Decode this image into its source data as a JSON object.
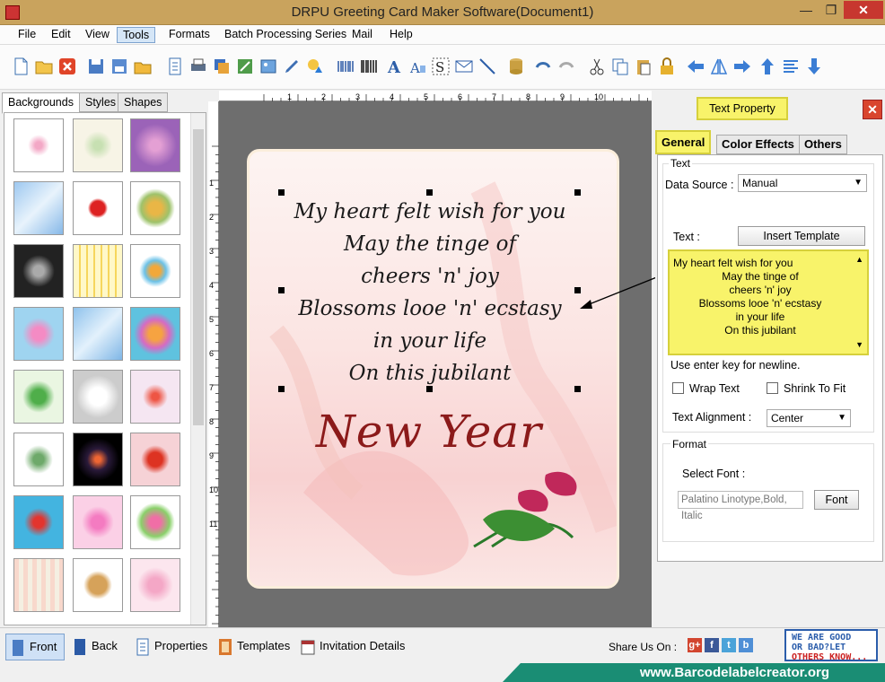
{
  "window": {
    "title": "DRPU Greeting Card Maker Software(Document1)",
    "min": "—",
    "max": "❐",
    "close": "✕"
  },
  "menu": [
    "File",
    "Edit",
    "View",
    "Tools",
    "Formats",
    "Batch Processing Series",
    "Mail",
    "Help"
  ],
  "left_tabs": [
    "Backgrounds",
    "Styles",
    "Shapes"
  ],
  "card": {
    "lines": [
      "My heart felt wish for you",
      "May the tinge of",
      "cheers 'n' joy",
      "Blossoms looe 'n' ecstasy",
      "in your life",
      "On this jubilant"
    ],
    "headline": "New Year"
  },
  "ruler": {
    "top": [
      "1",
      "2",
      "3",
      "4",
      "5",
      "6",
      "7",
      "8",
      "9",
      "10"
    ],
    "left": [
      "1",
      "2",
      "3",
      "4",
      "5",
      "6",
      "7",
      "8",
      "9",
      "10",
      "11"
    ]
  },
  "right_panel": {
    "title": "Text Property",
    "tabs": [
      "General",
      "Color Effects",
      "Others"
    ],
    "text_group": "Text",
    "data_source_label": "Data Source :",
    "data_source_value": "Manual",
    "text_label": "Text :",
    "insert_template": "Insert Template",
    "text_lines": [
      "My heart felt wish for you",
      "May the tinge of",
      "cheers 'n' joy",
      "Blossoms looe 'n' ecstasy",
      "in your life",
      "On this jubilant"
    ],
    "hint": "Use enter key for newline.",
    "wrap_text": "Wrap Text",
    "shrink_to_fit": "Shrink To Fit",
    "alignment_label": "Text Alignment :",
    "alignment_value": "Center",
    "format_group": "Format",
    "select_font_label": "Select Font :",
    "font_value": "Palatino Linotype,Bold, Italic",
    "font_button": "Font"
  },
  "bottom": {
    "front": "Front",
    "back": "Back",
    "properties": "Properties",
    "templates": "Templates",
    "invitation": "Invitation Details",
    "share_label": "Share Us On :",
    "social": [
      "g+",
      "f",
      "t",
      "b"
    ],
    "badge_lines": [
      "WE ARE GOOD",
      "OR BAD?LET",
      "OTHERS KNOW..."
    ]
  },
  "footer": "www.Barcodelabelcreator.org",
  "colors": {
    "titlebar": "#c9a35d",
    "highlight": "#f8f36a",
    "headline": "#8b1a1a",
    "footer": "#1a8d74"
  }
}
